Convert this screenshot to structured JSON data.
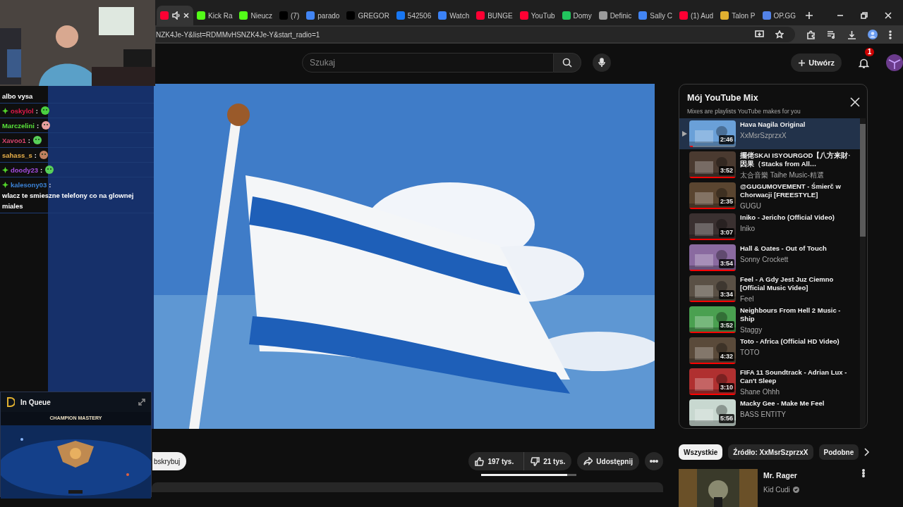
{
  "browser": {
    "tabs": [
      {
        "color": "#ff0033",
        "selected": true,
        "audio": true
      },
      {
        "label": "Kick Ra",
        "color": "#53fc18",
        "selected": false
      },
      {
        "label": "Nieucz",
        "color": "#53fc18",
        "selected": false
      },
      {
        "label": "(7)",
        "color": "#000000",
        "selected": false
      },
      {
        "label": "parado",
        "color": "#4285f4",
        "selected": false
      },
      {
        "label": "GREGOR",
        "color": "#000000",
        "selected": false
      },
      {
        "label": "542506",
        "color": "#1877f2",
        "selected": false
      },
      {
        "label": "Watch",
        "color": "#3b82f6",
        "selected": false
      },
      {
        "label": "BUNGE",
        "color": "#ff0033",
        "selected": false
      },
      {
        "label": "YouTub",
        "color": "#ff0033",
        "selected": false
      },
      {
        "label": "Domy",
        "color": "#22c55e",
        "selected": false
      },
      {
        "label": "Definic",
        "color": "#9a9a9a",
        "selected": false
      },
      {
        "label": "Sally C",
        "color": "#4285f4",
        "selected": false
      },
      {
        "label": "(1) Aud",
        "color": "#ff0033",
        "selected": false
      },
      {
        "label": "Talon P",
        "color": "#e0b030",
        "selected": false
      },
      {
        "label": "OP.GG",
        "color": "#5383e8",
        "selected": false
      }
    ],
    "address": "NZK4Je-Y&list=RDMMvHSNZK4Je-Y&start_radio=1"
  },
  "header": {
    "search": {
      "placeholder": "Szukaj"
    },
    "create": "Utwórz",
    "notifications": "1"
  },
  "video": {
    "subscribe": "bskrybuj",
    "likes": "197 tys.",
    "dislikes": "21 tys.",
    "share": "Udostępnij",
    "sentiment": {
      "level": 0.9
    }
  },
  "playlist": {
    "title": "Mój YouTube Mix",
    "subtitle": "Mixes are playlists YouTube makes for you",
    "items": [
      {
        "title": "Hava Nagila Original",
        "channel": "XxMsrSzprzxX",
        "duration": "2:46",
        "selected": true,
        "level": 0.08
      },
      {
        "title": "擺佬SKAI ISYOURGOD【八方来財·因果（Stacks from All…",
        "channel": "太合音樂 Taihe Music-精選",
        "duration": "3:52",
        "selected": false,
        "level": 1
      },
      {
        "title": "@GUGUMOVEMENT - Śmierč w Chorwacji [FREESTYLE]",
        "channel": "GUGU",
        "duration": "2:35",
        "selected": false,
        "level": 1
      },
      {
        "title": "Iniko - Jericho (Official Video)",
        "channel": "Iniko",
        "duration": "3:07",
        "selected": false,
        "level": 1
      },
      {
        "title": "Hall & Oates - Out of Touch",
        "channel": "Sonny Crockett",
        "duration": "3:54",
        "selected": false,
        "level": 1
      },
      {
        "title": "Feel - A Gdy Jest Juz Ciemno [Official Music Video]",
        "channel": "Feel",
        "duration": "3:34",
        "selected": false,
        "level": 1
      },
      {
        "title": "Neighbours From Hell 2 Music - Ship",
        "channel": "Staggy",
        "duration": "3:52",
        "selected": false,
        "level": 1
      },
      {
        "title": "Toto - Africa (Official HD Video)",
        "channel": "TOTO",
        "duration": "4:32",
        "selected": false,
        "level": 1
      },
      {
        "title": "FIFA 11 Soundtrack - Adrian Lux - Can't Sleep",
        "channel": "Shane Ohhh",
        "duration": "3:10",
        "selected": false,
        "level": 1
      },
      {
        "title": "Macky Gee - Make Me Feel",
        "channel": "BASS ENTITY",
        "duration": "5:56",
        "selected": false
      }
    ]
  },
  "chips": [
    {
      "label": "Wszystkie",
      "selected": true
    },
    {
      "label": "Źródło: XxMsrSzprzxX",
      "selected": false
    },
    {
      "label": "Podobne",
      "selected": false
    }
  ],
  "recommendation": {
    "title": "Mr. Rager",
    "channel": "Kid Cudi",
    "verified": true
  },
  "stream_chat": [
    {
      "text": "albo vysa"
    },
    {
      "user": "oskylol",
      "color": "#e0194a",
      "separator": ":",
      "badge": true,
      "emote": true
    },
    {
      "user": "Marczelini",
      "color": "#58e03a",
      "separator": ":",
      "badge": false,
      "emote": true
    },
    {
      "user": "Xavoo1",
      "color": "#d9446e",
      "separator": ":",
      "badge": false,
      "emote": true
    },
    {
      "user": "sahass_s",
      "color": "#e8b04a",
      "separator": ":",
      "badge": false,
      "emote": true
    },
    {
      "user": "doody23",
      "color": "#a64de0",
      "separator": ":",
      "badge": true,
      "emote": true
    },
    {
      "user": "kalesony03",
      "color": "#3b82d6",
      "separator": ":",
      "badge": true,
      "text": "wlacz te smieszne telefony co na glownej miales"
    }
  ],
  "queue_overlay": {
    "title": "In Queue",
    "heading": "CHAMPION MASTERY"
  }
}
